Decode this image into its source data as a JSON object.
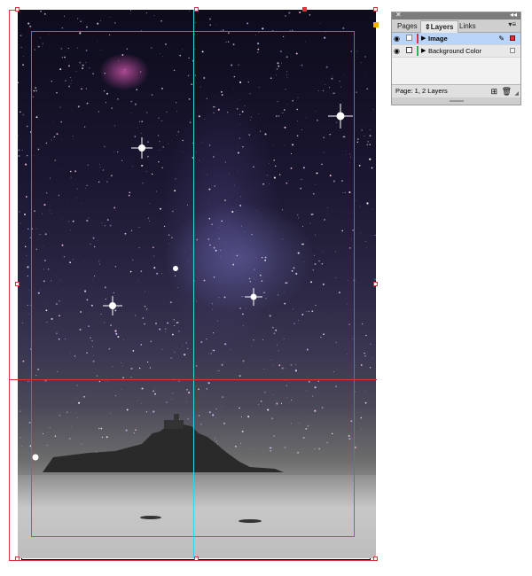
{
  "colors": {
    "guide_margin": "#c538c5",
    "guide_column": "#2fd6e0",
    "guide_bleed": "#e0303b",
    "layer_image": "#e0303b",
    "layer_background": "#2fb34a",
    "selection": "#b9d4f6"
  },
  "panel": {
    "close_icon": "close-icon",
    "collapse_glyph": "◂◂",
    "tabs": [
      {
        "label": "Pages",
        "active": false
      },
      {
        "label": "Layers",
        "active": true
      },
      {
        "label": "Links",
        "active": false
      }
    ],
    "menu_glyph": "▾≡",
    "layers": [
      {
        "name": "Image",
        "visible": true,
        "locked": false,
        "selected": true
      },
      {
        "name": "Background Color",
        "visible": true,
        "locked": true,
        "selected": false
      }
    ],
    "status": "Page: 1, 2 Layers"
  }
}
